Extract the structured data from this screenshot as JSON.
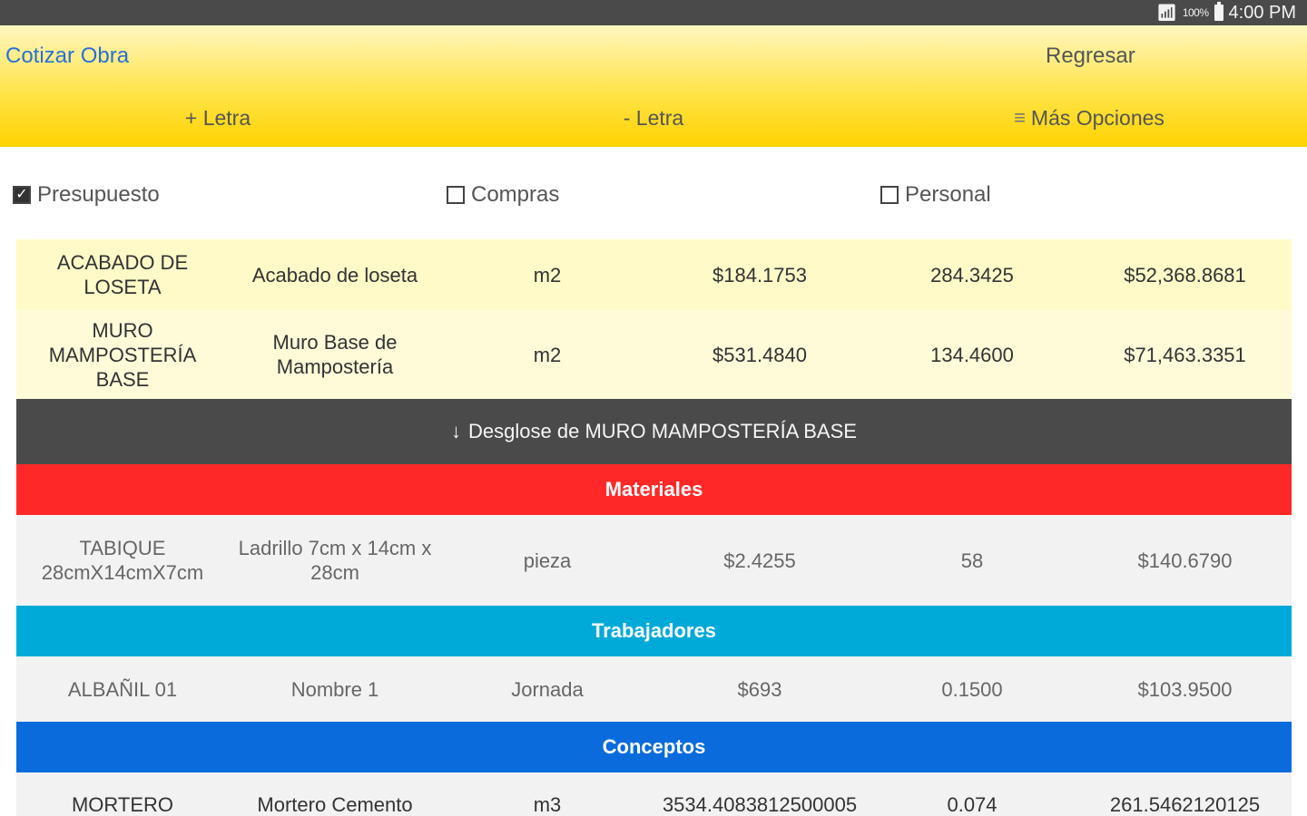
{
  "status_bar": {
    "battery": "100%",
    "time": "4:00 PM"
  },
  "header": {
    "title": "Cotizar Obra",
    "back_label": "Regresar",
    "toolbar": {
      "font_up": "+ Letra",
      "font_down": "- Letra",
      "more": "Más Opciones"
    }
  },
  "filters": [
    {
      "label": "Presupuesto",
      "checked": true
    },
    {
      "label": "Compras",
      "checked": false
    },
    {
      "label": "Personal",
      "checked": false
    }
  ],
  "budget_rows": [
    {
      "code": "ACABADO DE LOSETA",
      "name": "Acabado de loseta",
      "unit": "m2",
      "price": "$184.1753",
      "qty": "284.3425",
      "total": "$52,368.8681"
    },
    {
      "code": "MURO MAMPOSTERÍA BASE",
      "name": "Muro Base de Mampostería",
      "unit": "m2",
      "price": "$531.4840",
      "qty": "134.4600",
      "total": "$71,463.3351"
    }
  ],
  "breakdown": {
    "title": "Desglose de MURO MAMPOSTERÍA BASE",
    "sections": {
      "materiales": "Materiales",
      "trabajadores": "Trabajadores",
      "conceptos": "Conceptos"
    },
    "materiales_rows": [
      {
        "code": "TABIQUE 28cmX14cmX7cm",
        "name": "Ladrillo 7cm x 14cm x 28cm",
        "unit": "pieza",
        "price": "$2.4255",
        "qty": "58",
        "total": "$140.6790"
      }
    ],
    "trabajadores_rows": [
      {
        "code": "ALBAÑIL 01",
        "name": "Nombre 1",
        "unit": "Jornada",
        "price": "$693",
        "qty": "0.1500",
        "total": "$103.9500"
      }
    ],
    "conceptos_rows": [
      {
        "code": "MORTERO CEMENTO",
        "name": "Mortero Cemento",
        "unit": "m3",
        "price": "3534.4083812500005",
        "qty": "0.074",
        "total": "261.5462120125"
      }
    ]
  }
}
